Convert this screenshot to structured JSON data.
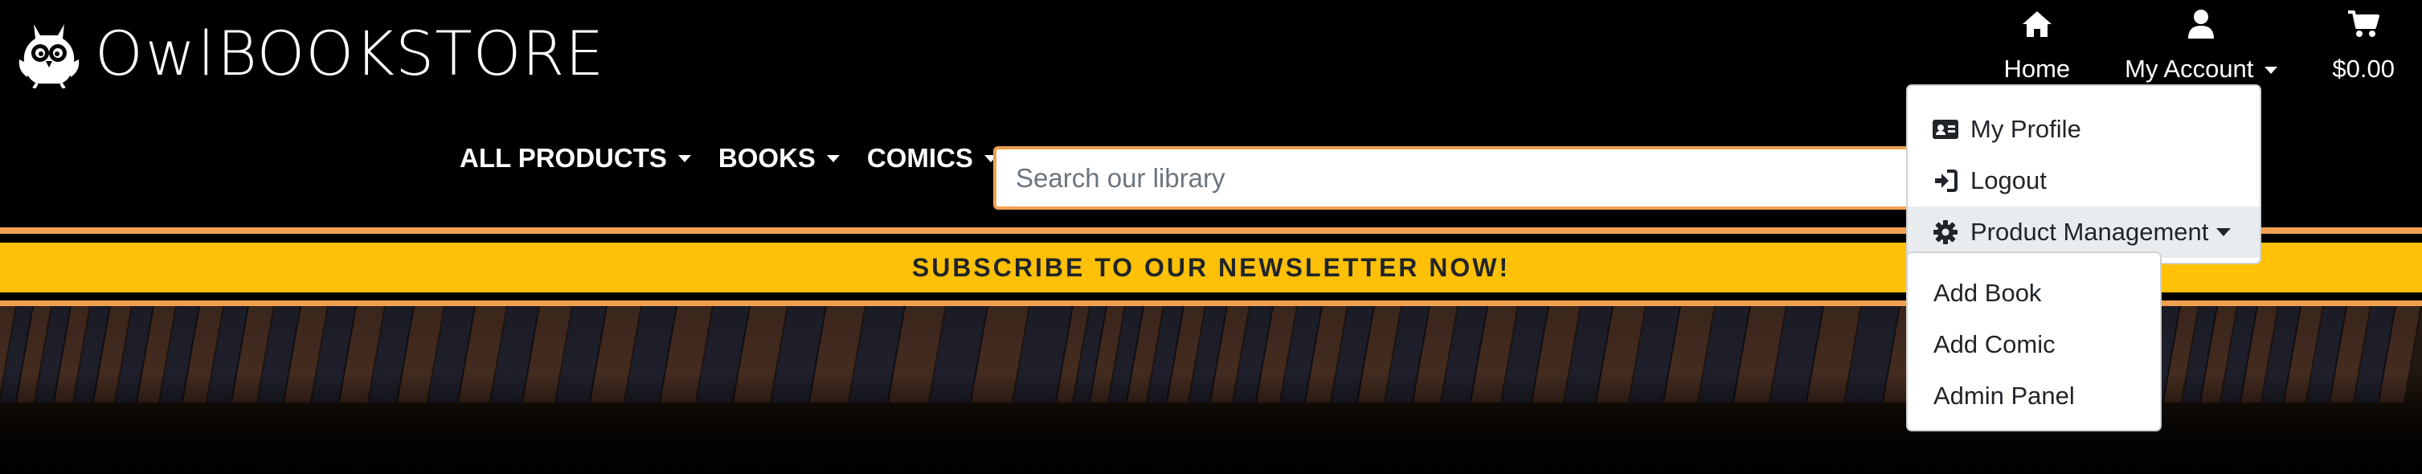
{
  "brand": {
    "name_part1": "Owl",
    "name_part2": "BOOKSTORE"
  },
  "top_nav": {
    "home_label": "Home",
    "account_label": "My Account",
    "cart_total": "$0.00"
  },
  "categories": [
    {
      "label": "ALL PRODUCTS"
    },
    {
      "label": "BOOKS"
    },
    {
      "label": "COMICS"
    }
  ],
  "search": {
    "placeholder": "Search our library"
  },
  "banner": {
    "text": "SUBSCRIBE TO OUR NEWSLETTER NOW!"
  },
  "account_menu": {
    "items": [
      {
        "label": "My Profile",
        "icon": "id-card-icon"
      },
      {
        "label": "Logout",
        "icon": "sign-in-icon"
      },
      {
        "label": "Product Management",
        "icon": "gear-icon",
        "active": true
      }
    ]
  },
  "product_management_menu": {
    "items": [
      {
        "label": "Add Book"
      },
      {
        "label": "Add Comic"
      },
      {
        "label": "Admin Panel"
      }
    ]
  },
  "colors": {
    "background": "#000000",
    "accent_orange": "#f0a050",
    "banner_yellow": "#ffc107",
    "menu_active_bg": "#e9ecef"
  }
}
